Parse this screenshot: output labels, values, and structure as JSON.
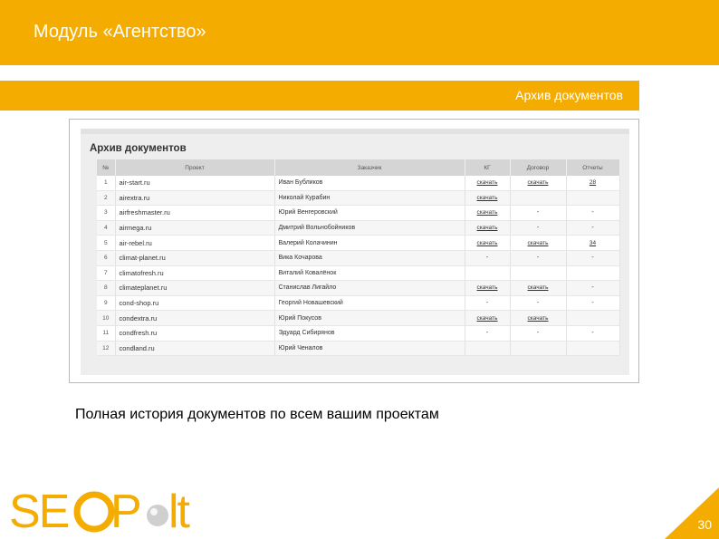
{
  "header": {
    "title": "Модуль «Агентство»"
  },
  "section": {
    "title": "Архив документов"
  },
  "screenshot": {
    "heading": "Архив документов",
    "columns": [
      "№",
      "Проект",
      "Заказчик",
      "КГ",
      "Договор",
      "Отчеты"
    ],
    "rows": [
      {
        "num": "1",
        "project": "air-start.ru",
        "client": "Иван Бубликов",
        "kg": "скачать",
        "contract": "скачать",
        "reports": "28"
      },
      {
        "num": "2",
        "project": "airextra.ru",
        "client": "Николай Курабин",
        "kg": "скачать",
        "contract": "",
        "reports": ""
      },
      {
        "num": "3",
        "project": "airfreshmaster.ru",
        "client": "Юрий Венгеровский",
        "kg": "скачать",
        "contract": "-",
        "reports": "-"
      },
      {
        "num": "4",
        "project": "airmega.ru",
        "client": "Дмитрий Вольнобойников",
        "kg": "скачать",
        "contract": "-",
        "reports": "-"
      },
      {
        "num": "5",
        "project": "air-rebel.ru",
        "client": "Валерий Колачинин",
        "kg": "скачать",
        "contract": "скачать",
        "reports": "34"
      },
      {
        "num": "6",
        "project": "climat-planet.ru",
        "client": "Вика Кочарова",
        "kg": "-",
        "contract": "-",
        "reports": "-"
      },
      {
        "num": "7",
        "project": "climatofresh.ru",
        "client": "Виталий Ковалёнок",
        "kg": "",
        "contract": "",
        "reports": ""
      },
      {
        "num": "8",
        "project": "climateplanet.ru",
        "client": "Станислав Лигайло",
        "kg": "скачать",
        "contract": "скачать",
        "reports": "-"
      },
      {
        "num": "9",
        "project": "cond-shop.ru",
        "client": "Георгий Новашевский",
        "kg": "-",
        "contract": "-",
        "reports": "-"
      },
      {
        "num": "10",
        "project": "condextra.ru",
        "client": "Юрий Покусов",
        "kg": "скачать",
        "contract": "скачать",
        "reports": ""
      },
      {
        "num": "11",
        "project": "condfresh.ru",
        "client": "Эдуард Сибирянов",
        "kg": "-",
        "contract": "-",
        "reports": "-"
      },
      {
        "num": "12",
        "project": "condland.ru",
        "client": "Юрий Ченалов",
        "kg": "",
        "contract": "",
        "reports": ""
      }
    ]
  },
  "caption": "Полная история документов по всем вашим проектам",
  "logo": {
    "text": "SEOPult"
  },
  "page_number": "30",
  "colors": {
    "accent": "#f4ac00",
    "logo_gray": "#9a9a9a"
  }
}
